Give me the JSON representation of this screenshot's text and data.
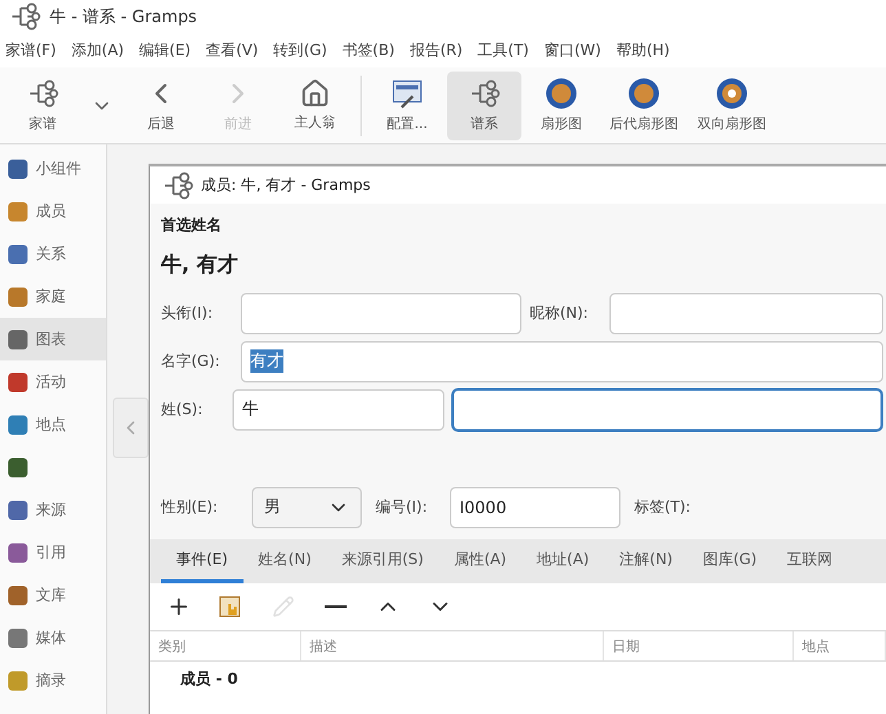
{
  "window": {
    "title": "牛 - 谱系 - Gramps"
  },
  "menu": [
    "家谱(F)",
    "添加(A)",
    "编辑(E)",
    "查看(V)",
    "转到(G)",
    "书签(B)",
    "报告(R)",
    "工具(T)",
    "窗口(W)",
    "帮助(H)"
  ],
  "toolbar": [
    {
      "kind": "tree",
      "label": "家谱",
      "disabled": false,
      "selected": false
    },
    {
      "kind": "dropdown",
      "disabled": false,
      "selected": false
    },
    {
      "kind": "back",
      "label": "后退",
      "disabled": false,
      "selected": false
    },
    {
      "kind": "forward",
      "label": "前进",
      "disabled": true,
      "selected": false
    },
    {
      "kind": "home",
      "label": "主人翁",
      "disabled": false,
      "selected": false
    },
    {
      "kind": "separator"
    },
    {
      "kind": "config",
      "label": "配置...",
      "disabled": false,
      "selected": false
    },
    {
      "kind": "tree",
      "label": "谱系",
      "disabled": false,
      "selected": true
    },
    {
      "kind": "fan",
      "label": "扇形图",
      "disabled": false,
      "selected": false
    },
    {
      "kind": "fan",
      "label": "后代扇形图",
      "disabled": false,
      "selected": false
    },
    {
      "kind": "twoway",
      "label": "双向扇形图",
      "disabled": false,
      "selected": false
    }
  ],
  "sidebar": {
    "items": [
      {
        "label": "小组件",
        "selected": false,
        "color": "#3a5f9a"
      },
      {
        "label": "成员",
        "selected": false,
        "color": "#c7862e"
      },
      {
        "label": "关系",
        "selected": false,
        "color": "#4a6fb0"
      },
      {
        "label": "家庭",
        "selected": false,
        "color": "#b8782a"
      },
      {
        "label": "图表",
        "selected": true,
        "color": "#666666"
      },
      {
        "label": "活动",
        "selected": false,
        "color": "#c0392b"
      },
      {
        "label": "地点",
        "selected": false,
        "color": "#2f7fb5"
      },
      {
        "selected": false,
        "color": "#3b5e2f"
      },
      {
        "label": "来源",
        "selected": false,
        "color": "#5068a8"
      },
      {
        "label": "引用",
        "selected": false,
        "color": "#8a5a9a"
      },
      {
        "label": "文库",
        "selected": false,
        "color": "#a0622a"
      },
      {
        "label": "媒体",
        "selected": false,
        "color": "#777777"
      },
      {
        "label": "摘录",
        "selected": false,
        "color": "#c09a2a"
      }
    ]
  },
  "dialog": {
    "title": "成员: 牛, 有才 - Gramps",
    "section_heading": "首选姓名",
    "name_display": "牛, 有才",
    "title_label": "头衔(I):",
    "nickname_label": "昵称(N):",
    "given_label": "名字(G):",
    "given_value": "有才",
    "given_value_selected": true,
    "surname_label": "姓(S):",
    "surname_value": "牛",
    "surname_origin_focused": true,
    "gender_label": "性别(E):",
    "gender_value": "男",
    "id_label": "编号(I):",
    "id_value": "I0000",
    "tags_label": "标签(T):",
    "tabs": [
      {
        "label": "事件(E)",
        "selected": true
      },
      {
        "label": "姓名(N)",
        "selected": false
      },
      {
        "label": "来源引用(S)",
        "selected": false
      },
      {
        "label": "属性(A)",
        "selected": false
      },
      {
        "label": "地址(A)",
        "selected": false
      },
      {
        "label": "注解(N)",
        "selected": false
      },
      {
        "label": "图库(G)",
        "selected": false
      },
      {
        "label": "互联网",
        "selected": false
      }
    ],
    "tab_toolbar": [
      {
        "kind": "add",
        "disabled": false
      },
      {
        "kind": "share",
        "disabled": false
      },
      {
        "kind": "edit",
        "disabled": true
      },
      {
        "kind": "remove",
        "disabled": false
      },
      {
        "kind": "up",
        "disabled": false
      },
      {
        "kind": "down",
        "disabled": false
      }
    ],
    "table": {
      "columns": [
        "类别",
        "描述",
        "日期",
        "地点"
      ],
      "rows": [
        {
          "label": "成员 - 0"
        }
      ]
    }
  }
}
